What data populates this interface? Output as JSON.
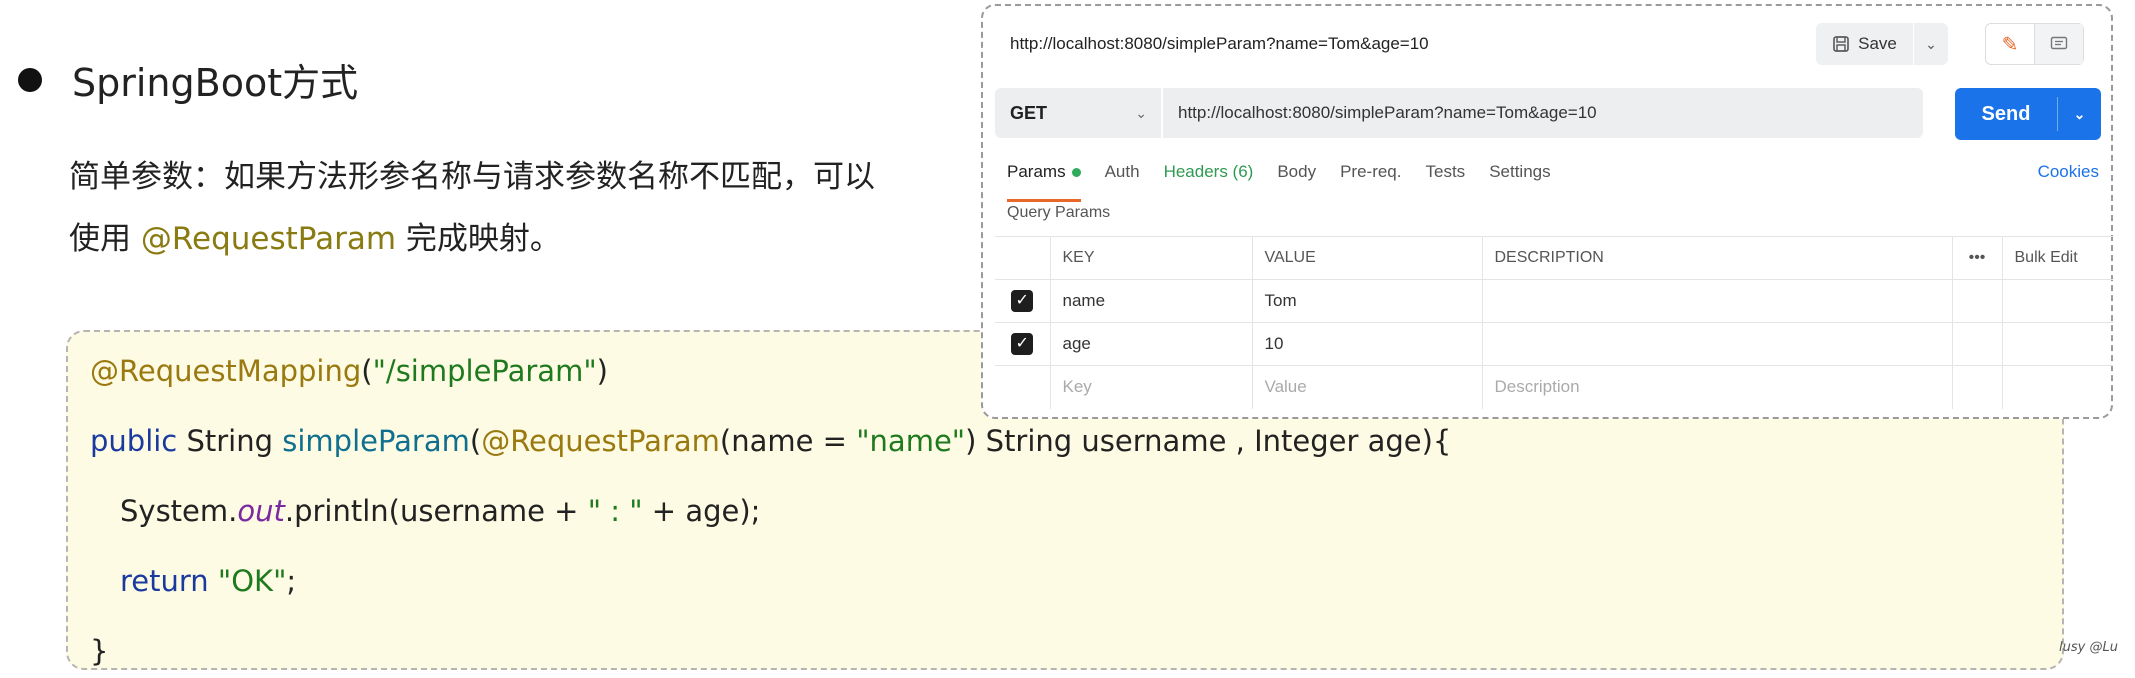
{
  "slide": {
    "heading": "SpringBoot方式",
    "desc_line1": "简单参数：如果方法形参名称与请求参数名称不匹配，可以",
    "desc_line2_pre": "使用 ",
    "desc_line2_hl": "@RequestParam",
    "desc_line2_post": " 完成映射。"
  },
  "code": {
    "l1_ann": "@RequestMapping",
    "l1_paren_open": "(",
    "l1_str": "\"/simpleParam\"",
    "l1_paren_close": ")",
    "l2_kw": "public",
    "l2_type": " String ",
    "l2_fn": "simpleParam",
    "l2_p1": "(",
    "l2_ann": "@RequestParam",
    "l2_p2": "(name = ",
    "l2_str": "\"name\"",
    "l2_p3": ") String username , Integer age){",
    "l3_pre": "System.",
    "l3_ital": "out",
    "l3_mid": ".println(username + ",
    "l3_str": "\" : \"",
    "l3_post": " + age);",
    "l4_kw": "return",
    "l4_sp": " ",
    "l4_str": "\"OK\"",
    "l4_end": ";",
    "l5": "}"
  },
  "postman": {
    "url_title": "http://localhost:8080/simpleParam?name=Tom&age=10",
    "save_label": "Save",
    "method": "GET",
    "url": "http://localhost:8080/simpleParam?name=Tom&age=10",
    "send_label": "Send",
    "tabs": {
      "params": "Params",
      "auth": "Auth",
      "headers": "Headers (6)",
      "body": "Body",
      "prereq": "Pre-req.",
      "tests": "Tests",
      "settings": "Settings"
    },
    "cookies": "Cookies",
    "query_params_label": "Query Params",
    "table": {
      "col_key": "KEY",
      "col_value": "VALUE",
      "col_desc": "DESCRIPTION",
      "bulk_edit": "Bulk Edit",
      "rows": [
        {
          "key": "name",
          "value": "Tom"
        },
        {
          "key": "age",
          "value": "10"
        }
      ],
      "ph_key": "Key",
      "ph_value": "Value",
      "ph_desc": "Description"
    }
  },
  "watermark": "lusy @Lu",
  "icons": {
    "save": "save-icon",
    "edit": "pencil-icon",
    "comment": "comment-icon",
    "check": "checkmark-icon"
  },
  "colors": {
    "send": "#1a73e8",
    "active_tab": "#e8682a",
    "code_bg": "#fdfbe3"
  }
}
